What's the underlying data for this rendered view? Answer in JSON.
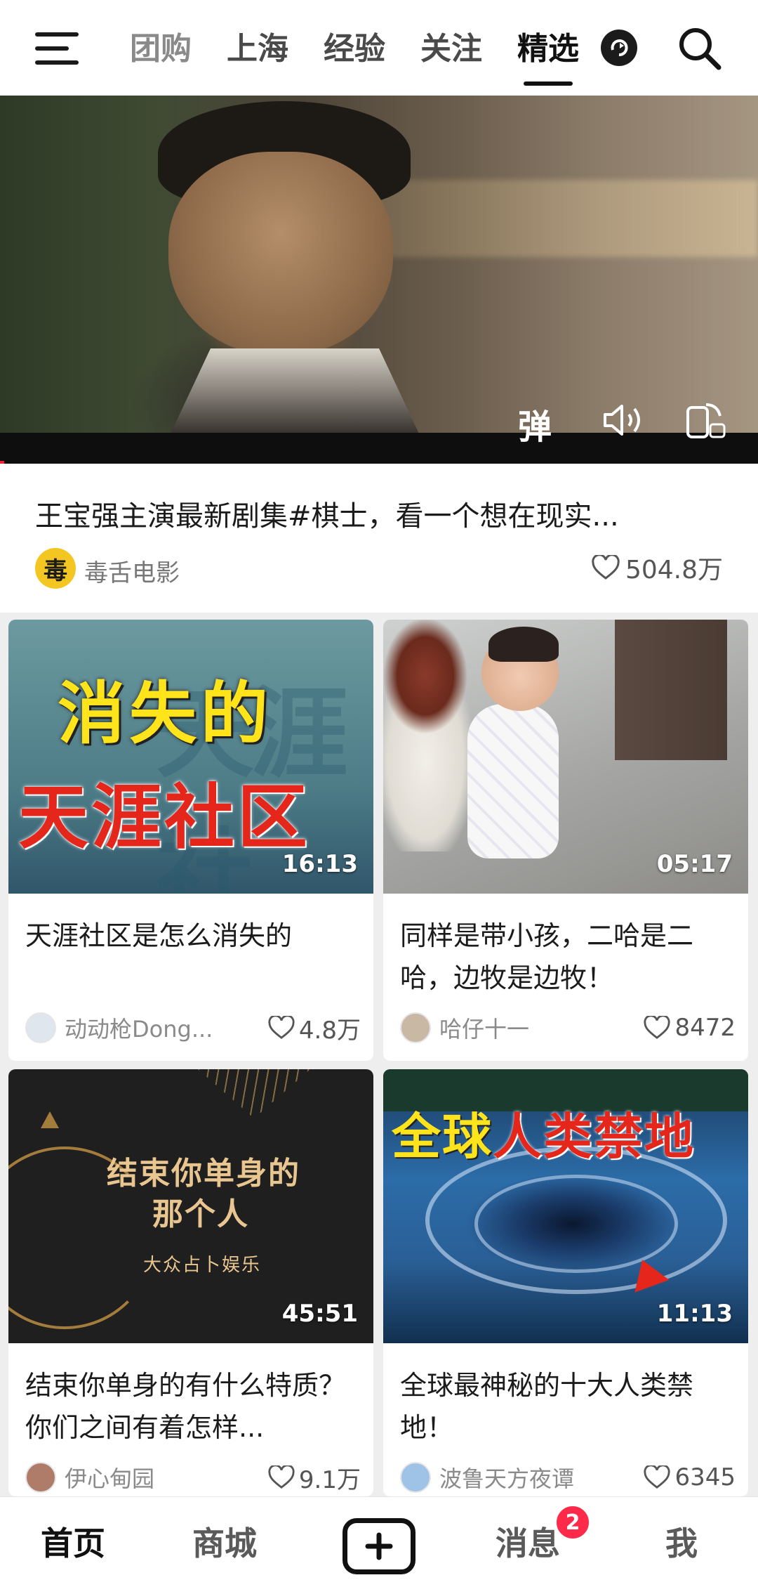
{
  "topbar": {
    "tabs": [
      "团购",
      "上海",
      "经验",
      "关注",
      "精选"
    ],
    "active_tab": "精选"
  },
  "hero": {
    "controls": {
      "danmu_label": "弹"
    },
    "title": "王宝强主演最新剧集#棋士，看一个想在现实...",
    "author": "毒舌电影",
    "author_avatar_char": "毒",
    "likes": "504.8万"
  },
  "cards": [
    {
      "thumb_text": [
        "消失的",
        "天涯社区"
      ],
      "duration": "16:13",
      "title": "天涯社区是怎么消失的",
      "author": "动动枪Dong...",
      "likes": "4.8万"
    },
    {
      "duration": "05:17",
      "title": "同样是带小孩，二哈是二哈，边牧是边牧！",
      "author": "哈仔十一",
      "likes": "8472"
    },
    {
      "thumb_text": [
        "结束你单身的",
        "那个人",
        "大众占卜娱乐"
      ],
      "duration": "45:51",
      "title": "结束你单身的有什么特质？你们之间有着怎样...",
      "author": "伊心甸园",
      "likes": "9.1万"
    },
    {
      "thumb_text": [
        "全球人类禁地"
      ],
      "duration": "11:13",
      "title": "全球最神秘的十大人类禁地！",
      "author": "波鲁天方夜谭",
      "likes": "6345"
    }
  ],
  "bottombar": {
    "items": [
      "首页",
      "商城",
      "消息",
      "我"
    ],
    "active": "首页",
    "message_badge": "2"
  },
  "colors": {
    "accent_badge": "#ff2a4a",
    "thumb_yellow": "#ffe41b",
    "thumb_red": "#e4261b",
    "avatar_yellow": "#f4c621"
  },
  "icons": [
    "menu-icon",
    "refresh-icon",
    "search-icon",
    "volume-icon",
    "rotate-screen-icon",
    "heart-icon",
    "plus-icon"
  ]
}
